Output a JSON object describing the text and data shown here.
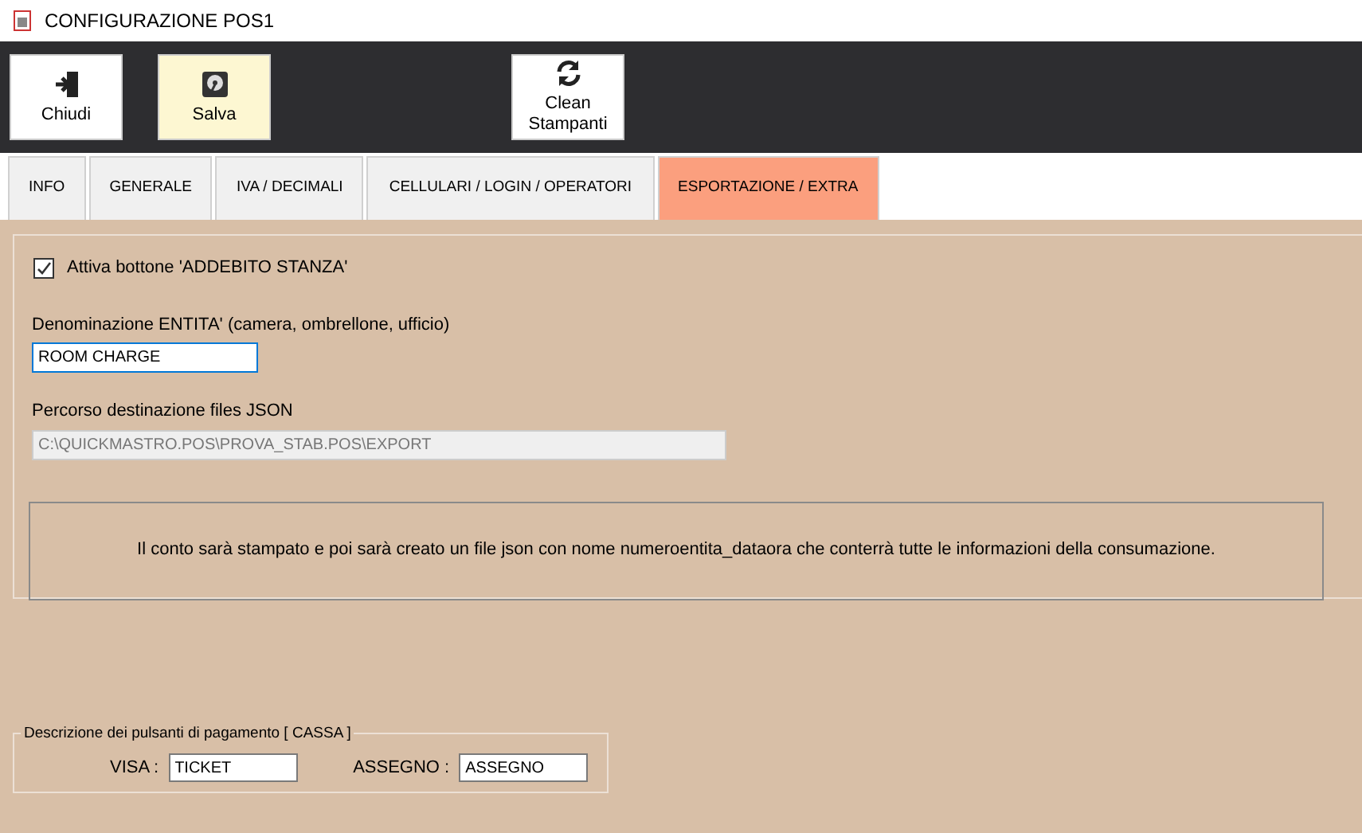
{
  "window": {
    "title": "CONFIGURAZIONE POS1"
  },
  "toolbar": [
    {
      "kind": "exit",
      "label": "Chiudi",
      "highlighted": false
    },
    {
      "kind": "disk",
      "label": "Salva",
      "highlighted": true
    },
    {
      "kind": "refresh",
      "label": "Clean Stampanti",
      "highlighted": false
    }
  ],
  "tabs": [
    {
      "label": "INFO",
      "selected": false
    },
    {
      "label": "GENERALE",
      "selected": false
    },
    {
      "label": "IVA / DECIMALI",
      "selected": false
    },
    {
      "label": "CELLULARI / LOGIN / OPERATORI",
      "selected": false
    },
    {
      "label": "ESPORTAZIONE / EXTRA",
      "selected": true
    }
  ],
  "room_charge": {
    "label": "Attiva bottone 'ADDEBITO STANZA'",
    "checked": true
  },
  "entity_name": {
    "label": "Denominazione ENTITA' (camera, ombrellone, ufficio)",
    "value": "ROOM CHARGE"
  },
  "json_path": {
    "label": "Percorso destinazione files JSON",
    "value": "C:\\QUICKMASTRO.POS\\PROVA_STAB.POS\\EXPORT",
    "disabled": true
  },
  "info_text": "Il conto sarà stampato e poi sarà creato un file json con nome numeroentita_dataora che conterrà tutte le informazioni della consumazione.",
  "payment_group": {
    "title": "Descrizione dei pulsanti di pagamento [ CASSA ]",
    "fields": [
      {
        "label": "VISA :",
        "value": "TICKET"
      },
      {
        "label": "ASSEGNO :",
        "value": "ASSEGNO"
      }
    ]
  }
}
